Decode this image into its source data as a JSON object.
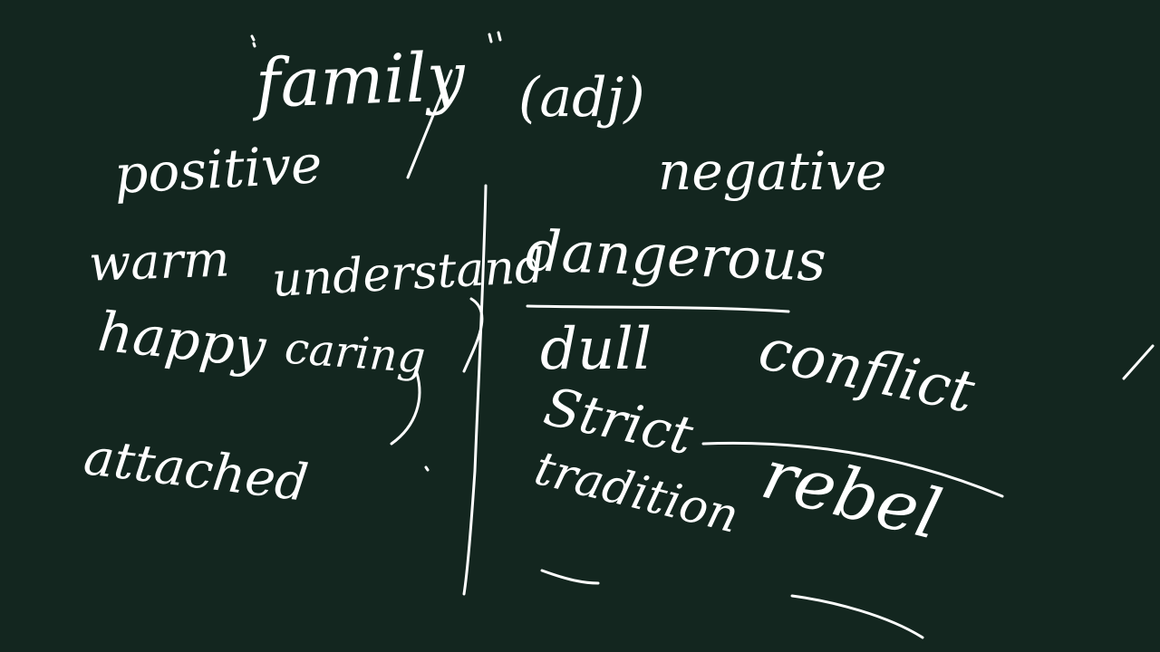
{
  "board": {
    "background": "#13261f",
    "ink_color": "#ffffff"
  },
  "title": {
    "word": "family",
    "pos": "(adj)"
  },
  "positive": {
    "heading": "positive",
    "words": [
      "warm",
      "understand",
      "happy",
      "caring",
      "attached"
    ]
  },
  "negative": {
    "heading": "negative",
    "words": [
      "dangerous",
      "dull",
      "Strict",
      "tradition",
      "conflict",
      "rebel"
    ]
  }
}
